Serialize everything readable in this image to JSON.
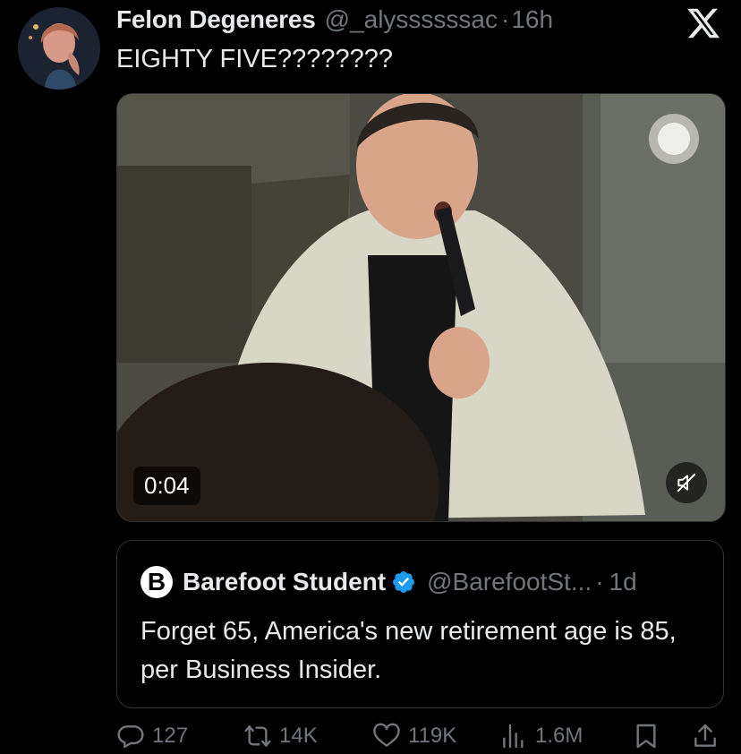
{
  "author": {
    "name": "Felon Degeneres",
    "handle": "@_alyssssssac",
    "separator": "·",
    "time": "16h"
  },
  "tweet": {
    "text": "EIGHTY FIVE????????"
  },
  "media": {
    "duration": "0:04",
    "muted_icon": "speaker-muted-icon"
  },
  "quote": {
    "logo_letter": "B",
    "name": "Barefoot Student",
    "handle": "@BarefootSt...",
    "separator": "·",
    "time": "1d",
    "text": "Forget 65, America's new retirement age is 85, per Business Insider."
  },
  "actions": {
    "replies": "127",
    "reposts": "14K",
    "likes": "119K",
    "views": "1.6M"
  },
  "colors": {
    "background": "#000000",
    "text": "#e7e9ea",
    "muted": "#71767b",
    "border": "#2f3336",
    "verified": "#1d9bf0"
  }
}
